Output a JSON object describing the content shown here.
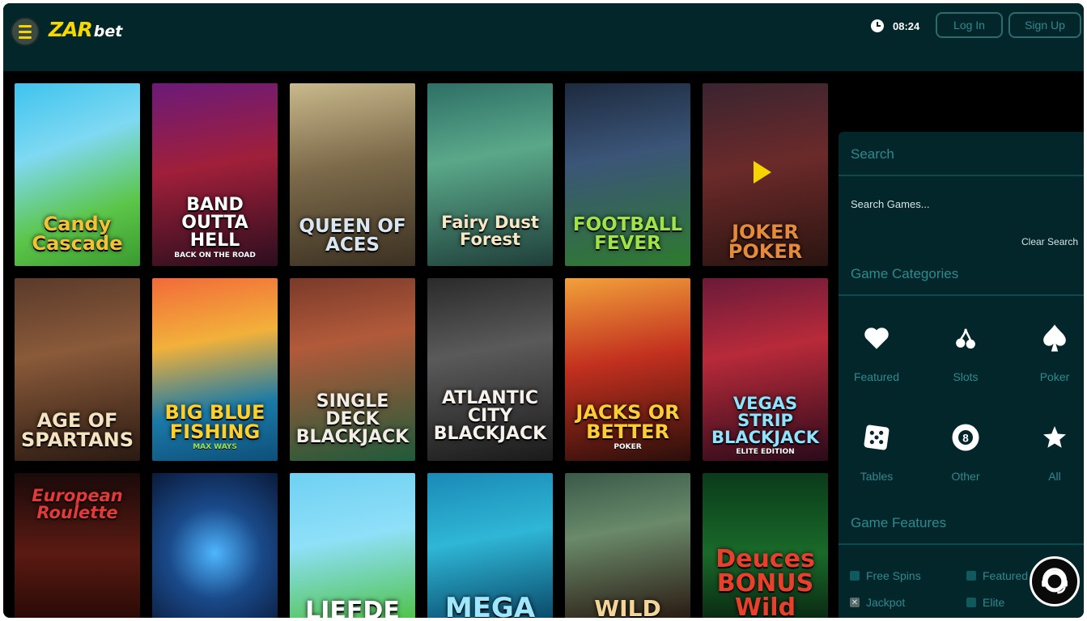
{
  "brand": {
    "logo_main": "ZAR",
    "logo_sub": "bet"
  },
  "header": {
    "time": "08:24",
    "login_label": "Log In",
    "signup_label": "Sign Up"
  },
  "games": [
    {
      "title": "Candy Cascade",
      "subtitle": "",
      "color": "#f2c237"
    },
    {
      "title": "BAND OUTTA HELL",
      "subtitle": "BACK ON THE ROAD",
      "color": "#ffffff"
    },
    {
      "title": "QUEEN OF ACES",
      "subtitle": "",
      "color": "#d9e6ef"
    },
    {
      "title": "Fairy Dust Forest",
      "subtitle": "",
      "color": "#f4e7c4"
    },
    {
      "title": "FOOTBALL FEVER",
      "subtitle": "",
      "color": "#9fe34a"
    },
    {
      "title": "JOKER POKER",
      "subtitle": "",
      "color": "#e58a3a"
    },
    {
      "title": "AGE OF SPARTANS",
      "subtitle": "",
      "color": "#f3e3c1"
    },
    {
      "title": "BIG BLUE FISHING",
      "subtitle": "MAX WAYS",
      "color": "#ffd02a"
    },
    {
      "title": "SINGLE DECK BLACKJACK",
      "subtitle": "",
      "color": "#f1ece4"
    },
    {
      "title": "ATLANTIC CITY BLACKJACK",
      "subtitle": "",
      "color": "#f6f1ea"
    },
    {
      "title": "JACKS OR BETTER",
      "subtitle": "POKER",
      "color": "#ffcc33"
    },
    {
      "title": "VEGAS STRIP BLACKJACK",
      "subtitle": "ELITE EDITION",
      "color": "#8fe3ff"
    },
    {
      "title": "European Roulette",
      "subtitle": "",
      "color": "#e23a3a"
    },
    {
      "title": "",
      "subtitle": "",
      "color": "#ffffff"
    },
    {
      "title": "LIEFDE",
      "subtitle": "",
      "color": "#ffffff"
    },
    {
      "title": "MEGA",
      "subtitle": "",
      "color": "#9fe6ff"
    },
    {
      "title": "WILD",
      "subtitle": "",
      "color": "#f3d59a"
    },
    {
      "title": "Deuces BONUS Wild",
      "subtitle": "",
      "color": "#e8402c"
    }
  ],
  "sidebar": {
    "search_title": "Search",
    "search_placeholder": "Search Games...",
    "clear_label": "Clear Search",
    "categories_title": "Game Categories",
    "categories": [
      {
        "label": "Featured",
        "icon": "heart-icon"
      },
      {
        "label": "Slots",
        "icon": "cherries-icon"
      },
      {
        "label": "Poker",
        "icon": "spade-icon"
      },
      {
        "label": "Tables",
        "icon": "dice-icon"
      },
      {
        "label": "Other",
        "icon": "eight-ball-icon"
      },
      {
        "label": "All",
        "icon": "star-icon"
      }
    ],
    "features_title": "Game Features",
    "features": [
      {
        "label": "Free Spins",
        "checked": false
      },
      {
        "label": "Featured",
        "checked": false
      },
      {
        "label": "Jackpot",
        "checked": true
      },
      {
        "label": "Elite",
        "checked": false
      }
    ]
  },
  "colors": {
    "accent": "#f5d400",
    "header_bg": "#02262a",
    "teal_text": "#2f8a90"
  }
}
